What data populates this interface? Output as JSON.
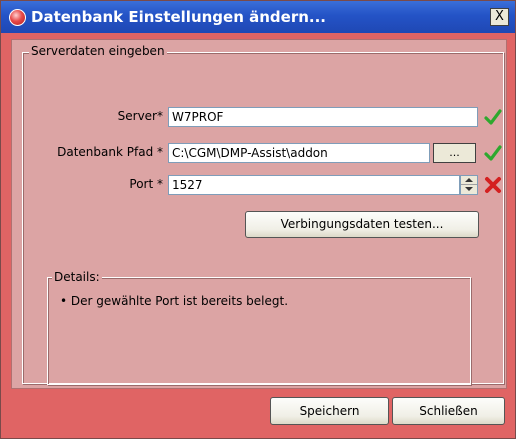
{
  "window": {
    "title": "Datenbank Einstellungen ändern...",
    "close_label": "X"
  },
  "server_group": {
    "legend": "Serverdaten eingeben",
    "server": {
      "label": "Server*",
      "value": "W7PROF",
      "status": "valid"
    },
    "db_path": {
      "label": "Datenbank Pfad *",
      "value": "C:\\CGM\\DMP-Assist\\addon",
      "browse_label": "...",
      "status": "valid"
    },
    "port": {
      "label": "Port *",
      "value": "1527",
      "status": "invalid"
    },
    "test_button_label": "Verbingungsdaten testen..."
  },
  "details": {
    "legend": "Details:",
    "bullet": "•",
    "message": "Der gewählte Port ist bereits belegt."
  },
  "footer": {
    "save_label": "Speichern",
    "close_label": "Schließen"
  },
  "colors": {
    "window_bg": "#e06464",
    "panel_bg": "#dca4a4",
    "title_bar": "#2453c6",
    "valid": "#2ea82e",
    "invalid": "#d42020"
  }
}
